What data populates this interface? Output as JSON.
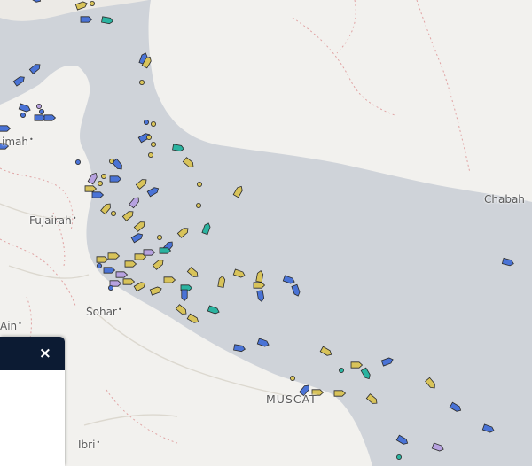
{
  "colors": {
    "sea": "#cfd3d9",
    "land": "#f2f1ee",
    "border": "#e0a3a3",
    "panel_header": "#0c1b33",
    "vessel_cargo": "#d8c35a",
    "vessel_tanker": "#4a73d6",
    "vessel_passenger": "#b7a2e0",
    "vessel_tug": "#2bb3a0",
    "vessel_outline": "#2b2b2b"
  },
  "map": {
    "places": [
      {
        "id": "ras-al-khaimah",
        "label": "imah",
        "has_dot": true
      },
      {
        "id": "fujairah",
        "label": "Fujairah",
        "has_dot": true
      },
      {
        "id": "sohar",
        "label": "Sohar",
        "has_dot": true
      },
      {
        "id": "al-ain",
        "label": "Ain",
        "has_dot": true
      },
      {
        "id": "muscat",
        "label": "MUSCAT",
        "has_dot": false
      },
      {
        "id": "ibri",
        "label": "Ibri",
        "has_dot": true
      },
      {
        "id": "chabahar",
        "label": "Chabah",
        "has_dot": false
      }
    ]
  },
  "panel": {
    "close_icon": "close-icon",
    "close_label": "×"
  }
}
